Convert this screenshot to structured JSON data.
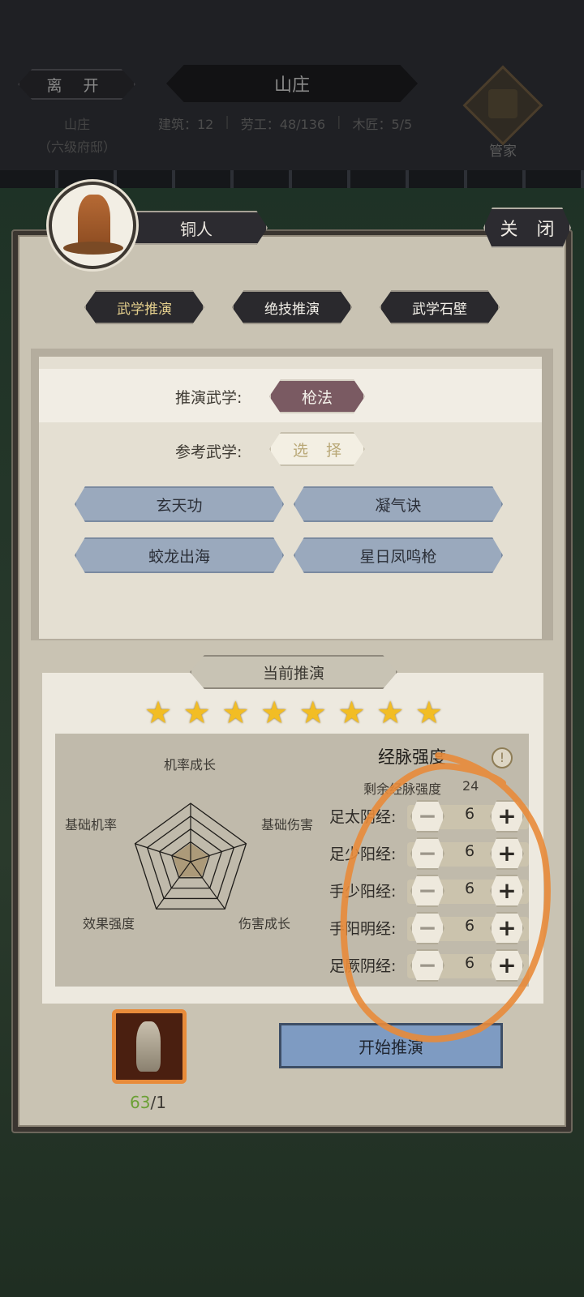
{
  "topbar": {
    "leave_label": "离 开",
    "estate_name": "山庄",
    "estate_level": "（六级府邸）",
    "title": "山庄",
    "stats": [
      "建筑：12",
      "劳工：48/136",
      "木匠：5/5"
    ],
    "butler_label": "管家"
  },
  "dialog": {
    "name": "铜人",
    "close_label": "关 闭",
    "tabs": [
      {
        "label": "武学推演",
        "active": true
      },
      {
        "label": "绝技推演",
        "active": false
      },
      {
        "label": "武学石壁",
        "active": false
      }
    ],
    "infer_label": "推演武学:",
    "infer_skill": "枪法",
    "ref_label": "参考武学:",
    "select_label": "选 择",
    "ref_skills": [
      "玄天功",
      "凝气诀",
      "蛟龙出海",
      "星日凤鸣枪"
    ],
    "current_label": "当前推演",
    "stars": 8,
    "radar": {
      "labels": [
        "机率成长",
        "基础伤害",
        "伤害成长",
        "效果强度",
        "基础机率"
      ]
    },
    "meridian": {
      "title": "经脉强度",
      "remaining_label": "剩余经脉强度",
      "remaining_value": "24",
      "rows": [
        {
          "label": "足太阴经:",
          "value": "6"
        },
        {
          "label": "足少阳经:",
          "value": "6"
        },
        {
          "label": "手少阳经:",
          "value": "6"
        },
        {
          "label": "手阳明经:",
          "value": "6"
        },
        {
          "label": "足厥阴经:",
          "value": "6"
        }
      ]
    },
    "item": {
      "count_have": "63",
      "count_need": "/1"
    },
    "start_label": "开始推演"
  },
  "colors": {
    "accent_star": "#f2bd24",
    "annotation": "#e88b3a",
    "start_button": "#7e9bc2"
  }
}
